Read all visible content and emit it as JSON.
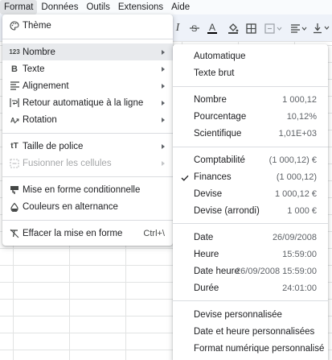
{
  "menubar": {
    "items": [
      "Format",
      "Données",
      "Outils",
      "Extensions",
      "Aide"
    ]
  },
  "format_menu": {
    "items": [
      {
        "label": "Thème",
        "icon": "palette-icon"
      },
      {
        "label": "Nombre",
        "icon": "number-format-icon",
        "icon_text": "123",
        "submenu": true,
        "selected": true
      },
      {
        "label": "Texte",
        "icon": "bold-icon",
        "icon_text": "B",
        "submenu": true
      },
      {
        "label": "Alignement",
        "icon": "align-left-icon",
        "submenu": true
      },
      {
        "label": "Retour automatique à la ligne",
        "icon": "text-wrap-icon",
        "submenu": true
      },
      {
        "label": "Rotation",
        "icon": "text-rotation-icon",
        "submenu": true
      },
      {
        "label": "Taille de police",
        "icon": "font-size-icon",
        "icon_text": "tT",
        "submenu": true
      },
      {
        "label": "Fusionner les cellules",
        "icon": "merge-cells-icon",
        "submenu": true,
        "disabled": true
      },
      {
        "label": "Mise en forme conditionnelle",
        "icon": "conditional-format-icon"
      },
      {
        "label": "Couleurs en alternance",
        "icon": "fill-drip-icon"
      },
      {
        "label": "Effacer la mise en forme",
        "icon": "clear-format-icon",
        "shortcut": "Ctrl+\\"
      }
    ]
  },
  "number_menu": {
    "items": [
      {
        "label": "Automatique"
      },
      {
        "label": "Texte brut"
      },
      {
        "label": "Nombre",
        "value": "1 000,12"
      },
      {
        "label": "Pourcentage",
        "value": "10,12%"
      },
      {
        "label": "Scientifique",
        "value": "1,01E+03"
      },
      {
        "label": "Comptabilité",
        "value": "(1 000,12) €"
      },
      {
        "label": "Finances",
        "value": "(1 000,12)",
        "checked": true
      },
      {
        "label": "Devise",
        "value": "1 000,12 €"
      },
      {
        "label": "Devise (arrondi)",
        "value": "1 000 €"
      },
      {
        "label": "Date",
        "value": "26/09/2008"
      },
      {
        "label": "Heure",
        "value": "15:59:00"
      },
      {
        "label": "Date heure",
        "value": "26/09/2008 15:59:00"
      },
      {
        "label": "Durée",
        "value": "24:01:00"
      },
      {
        "label": "Devise personnalisée"
      },
      {
        "label": "Date et heure personnalisées"
      },
      {
        "label": "Format numérique personnalisé"
      }
    ]
  },
  "toolbar": {
    "icons": [
      "italic-icon",
      "strikethrough-icon",
      "text-color-icon",
      "fill-color-icon",
      "borders-icon",
      "merge-icon",
      "horizontal-align-icon",
      "vertical-align-icon"
    ],
    "italic_glyph": "I",
    "text_color_glyph": "A",
    "text_color": "#000000"
  },
  "colors": {
    "menu_selected": "#e8eaed",
    "menubar_active": "#e1e3e6",
    "toolbar_bg": "#eef2f9",
    "disabled_text": "#a5a7a9"
  }
}
